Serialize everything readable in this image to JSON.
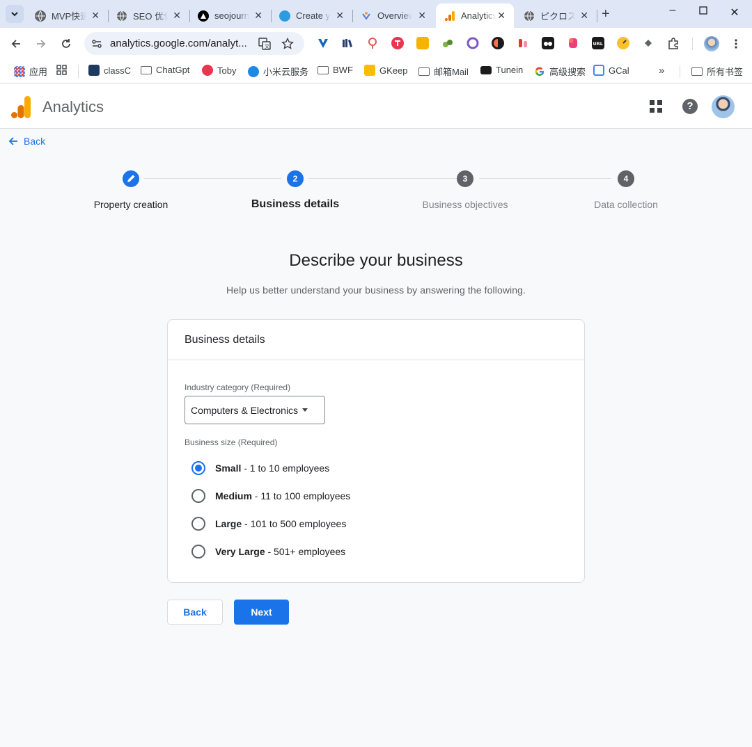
{
  "browser": {
    "tabs": [
      {
        "title": "MVP快速",
        "favicon": "globe-icon",
        "active": false
      },
      {
        "title": "SEO 优化",
        "favicon": "globe-icon",
        "active": false
      },
      {
        "title": "seojourney",
        "favicon": "seojourney-icon",
        "active": false
      },
      {
        "title": "Create y",
        "favicon": "cloud-icon",
        "active": false
      },
      {
        "title": "Overview",
        "favicon": "overview-icon",
        "active": false
      },
      {
        "title": "Analytics",
        "favicon": "analytics-icon",
        "active": true
      },
      {
        "title": "ピクロス",
        "favicon": "globe-icon",
        "active": false
      }
    ],
    "url": "analytics.google.com/analyt...",
    "extension_badge": "58",
    "bookmarks": [
      {
        "label": "应用",
        "icon": "apps-grid-icon"
      },
      {
        "label": "",
        "icon": "grid-icon"
      },
      {
        "label": "classC",
        "icon": "classc-icon"
      },
      {
        "label": "ChatGpt",
        "icon": "folder-icon"
      },
      {
        "label": "Toby",
        "icon": "toby-icon"
      },
      {
        "label": "小米云服务",
        "icon": "mi-cloud-icon"
      },
      {
        "label": "BWF",
        "icon": "folder-icon"
      },
      {
        "label": "GKeep",
        "icon": "keep-icon"
      },
      {
        "label": "邮箱Mail",
        "icon": "folder-icon"
      },
      {
        "label": "Tunein",
        "icon": "tunein-icon"
      },
      {
        "label": "高级搜索",
        "icon": "google-icon"
      },
      {
        "label": "GCal",
        "icon": "gcal-icon"
      }
    ],
    "all_bookmarks": "所有书签"
  },
  "app": {
    "title": "Analytics",
    "accent": "#1a73e8"
  },
  "nav": {
    "back_label": "Back"
  },
  "stepper": {
    "steps": [
      {
        "number": "",
        "label": "Property creation",
        "state": "completed"
      },
      {
        "number": "2",
        "label": "Business details",
        "state": "current"
      },
      {
        "number": "3",
        "label": "Business objectives",
        "state": "upcoming"
      },
      {
        "number": "4",
        "label": "Data collection",
        "state": "upcoming"
      }
    ]
  },
  "main": {
    "heading": "Describe your business",
    "subheading": "Help us better understand your business by answering the following."
  },
  "card": {
    "title": "Business details",
    "industry": {
      "label": "Industry category (Required)",
      "selected": "Computers & Electronics"
    },
    "size": {
      "label": "Business size (Required)",
      "options": [
        {
          "name": "Small",
          "detail": " - 1 to 10 employees",
          "checked": true
        },
        {
          "name": "Medium",
          "detail": " - 11 to 100 employees",
          "checked": false
        },
        {
          "name": "Large",
          "detail": " - 101 to 500 employees",
          "checked": false
        },
        {
          "name": "Very Large",
          "detail": " - 501+ employees",
          "checked": false
        }
      ]
    }
  },
  "actions": {
    "back_label": "Back",
    "next_label": "Next"
  }
}
